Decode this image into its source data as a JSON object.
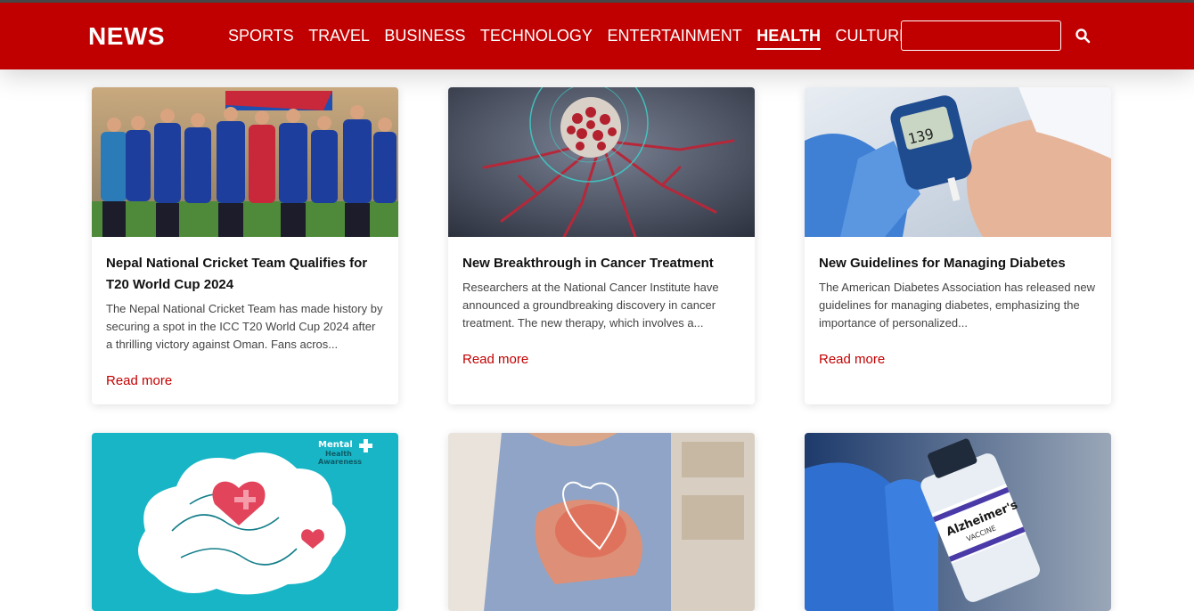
{
  "header": {
    "logo": "NEWS",
    "nav": [
      {
        "label": "SPORTS",
        "active": false
      },
      {
        "label": "TRAVEL",
        "active": false
      },
      {
        "label": "BUSINESS",
        "active": false
      },
      {
        "label": "TECHNOLOGY",
        "active": false
      },
      {
        "label": "ENTERTAINMENT",
        "active": false
      },
      {
        "label": "HEALTH",
        "active": true
      },
      {
        "label": "CULTURE",
        "active": false
      }
    ],
    "search_placeholder": "",
    "search_icon": "search-icon"
  },
  "colors": {
    "brand_red": "#c00000",
    "link_red": "#c40000"
  },
  "articles": [
    {
      "title": "Nepal National Cricket Team Qualifies for T20 World Cup 2024",
      "excerpt": "The Nepal National Cricket Team has made history by securing a spot in the ICC T20 World Cup 2024 after a thrilling victory against Oman. Fans acros...",
      "link": "Read more",
      "image": "cricket-team-celebration-image"
    },
    {
      "title": "New Breakthrough in Cancer Treatment",
      "excerpt": "Researchers at the National Cancer Institute have announced a groundbreaking discovery in cancer treatment. The new therapy, which involves a...",
      "link": "Read more",
      "image": "cancer-cell-image"
    },
    {
      "title": "New Guidelines for Managing Diabetes",
      "excerpt": "The American Diabetes Association has released new guidelines for managing diabetes, emphasizing the importance of personalized...",
      "link": "Read more",
      "image": "glucose-meter-image"
    },
    {
      "image": "mental-health-awareness-image",
      "image_text": [
        "Mental",
        "Health",
        "Awareness"
      ]
    },
    {
      "image": "heart-chest-pain-image"
    },
    {
      "image": "alzheimers-vaccine-image",
      "image_text": [
        "Alzheimer's",
        "VACCINE"
      ]
    }
  ]
}
